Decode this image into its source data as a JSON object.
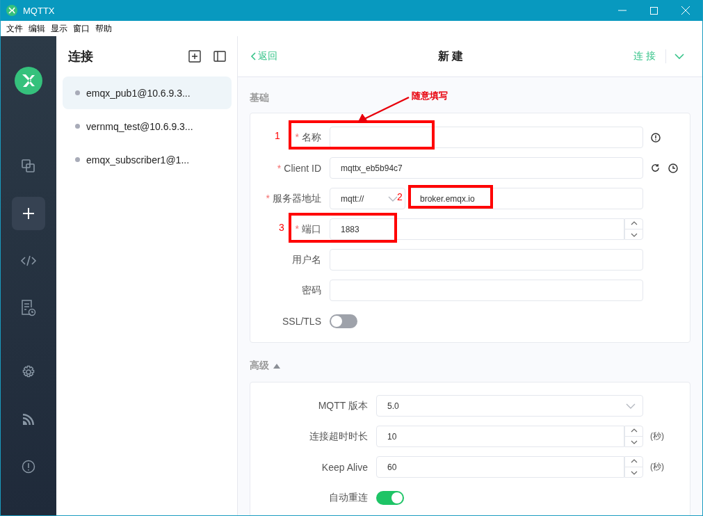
{
  "window": {
    "title": "MQTTX"
  },
  "menu": [
    "文件",
    "编辑",
    "显示",
    "窗口",
    "帮助"
  ],
  "nav_items": [
    {
      "kind": "connections",
      "selected": false
    },
    {
      "kind": "new",
      "selected": true
    },
    {
      "kind": "script",
      "selected": false
    },
    {
      "kind": "log",
      "selected": false
    },
    {
      "kind": "settings",
      "selected": false
    },
    {
      "kind": "benchmark",
      "selected": false
    },
    {
      "kind": "about",
      "selected": false
    }
  ],
  "connections": {
    "title": "连接",
    "items": [
      {
        "name": "emqx_pub1@10.6.9.3...",
        "selected": true
      },
      {
        "name": "vernmq_test@10.6.9.3...",
        "selected": false
      },
      {
        "name": "emqx_subscriber1@1...",
        "selected": false
      }
    ]
  },
  "header": {
    "back": "返回",
    "title": "新建",
    "connect": "连接"
  },
  "basic": {
    "title": "基础",
    "fields": [
      {
        "kind": "name",
        "required_mark": "*",
        "label": "名称"
      },
      {
        "kind": "client-id",
        "required_mark": "*",
        "label": "Client ID",
        "value": "mqttx_eb5b94c7"
      },
      {
        "kind": "host",
        "required_mark": "*",
        "label": "服务器地址",
        "protocol": "mqtt://",
        "value": "broker.emqx.io"
      },
      {
        "kind": "number",
        "required_mark": "*",
        "label": "端口",
        "value": "1883"
      },
      {
        "kind": "text",
        "label": "用户名"
      },
      {
        "kind": "text",
        "label": "密码"
      },
      {
        "kind": "toggle",
        "label": "SSL/TLS",
        "on": false
      }
    ]
  },
  "advanced": {
    "title": "高级",
    "expanded": true,
    "fields": [
      {
        "kind": "select",
        "label": "MQTT 版本",
        "value": "5.0"
      },
      {
        "kind": "number",
        "label": "连接超时时长",
        "value": "10",
        "unit": "(秒)"
      },
      {
        "kind": "number",
        "label": "Keep Alive",
        "value": "60",
        "unit": "(秒)"
      },
      {
        "kind": "toggle",
        "label": "自动重连",
        "on": true
      }
    ]
  },
  "annotations": {
    "note": "随意填写",
    "markers": [
      "1",
      "2",
      "3"
    ]
  }
}
